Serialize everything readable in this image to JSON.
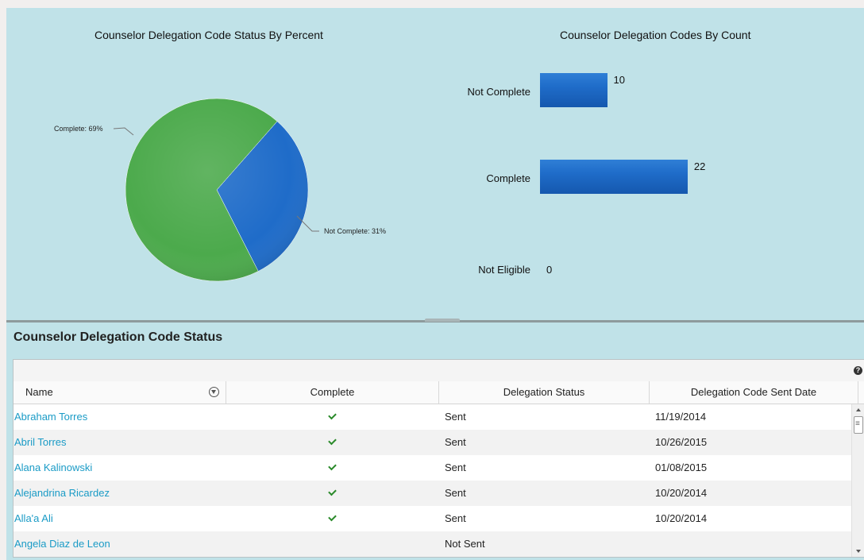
{
  "charts": {
    "pie_title": "Counselor Delegation Code Status By Percent",
    "bar_title": "Counselor Delegation Codes By Count"
  },
  "chart_data": [
    {
      "type": "pie",
      "title": "Counselor Delegation Code Status By Percent",
      "slices": [
        {
          "label": "Complete: 69%",
          "category": "Complete",
          "value": 69,
          "color": "#4caa4c"
        },
        {
          "label": "Not Complete: 31%",
          "category": "Not Complete",
          "value": 31,
          "color": "#1f6cc9"
        }
      ]
    },
    {
      "type": "bar",
      "orientation": "horizontal",
      "title": "Counselor Delegation Codes By Count",
      "categories": [
        "Not Complete",
        "Complete",
        "Not Eligible"
      ],
      "values": [
        10,
        22,
        0
      ],
      "value_labels": [
        "10",
        "22",
        "0"
      ],
      "color": "#1f6cc9"
    }
  ],
  "list": {
    "title": "Counselor Delegation Code Status",
    "help_icon": "?",
    "columns": {
      "name": "Name",
      "complete": "Complete",
      "status": "Delegation Status",
      "date": "Delegation Code Sent Date"
    },
    "rows": [
      {
        "name": "Abraham Torres",
        "complete": true,
        "status": "Sent",
        "date": "11/19/2014"
      },
      {
        "name": "Abril Torres",
        "complete": true,
        "status": "Sent",
        "date": "10/26/2015"
      },
      {
        "name": "Alana Kalinowski",
        "complete": true,
        "status": "Sent",
        "date": "01/08/2015"
      },
      {
        "name": "Alejandrina Ricardez",
        "complete": true,
        "status": "Sent",
        "date": "10/20/2014"
      },
      {
        "name": "Alla'a Ali",
        "complete": true,
        "status": "Sent",
        "date": "10/20/2014"
      },
      {
        "name": "Angela Diaz de Leon",
        "complete": false,
        "status": "Not Sent",
        "date": ""
      }
    ]
  },
  "colors": {
    "panel_bg": "#c0e2e8",
    "link": "#1a9bc6",
    "check": "#2a8a2a"
  }
}
